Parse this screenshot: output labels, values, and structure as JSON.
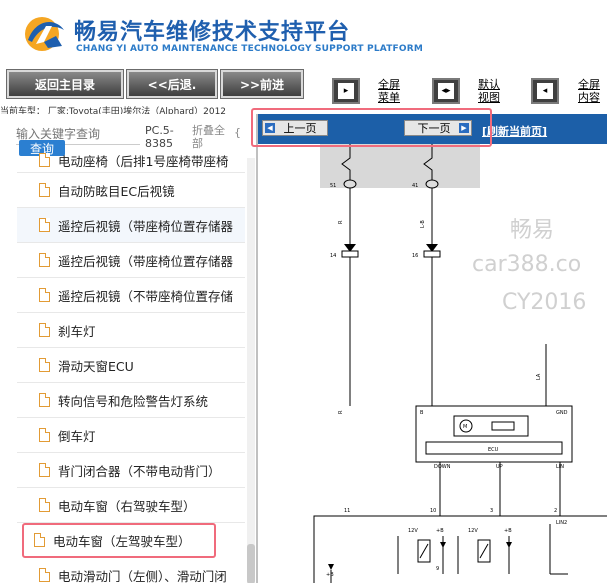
{
  "header": {
    "title_cn": "畅易汽车维修技术支持平台",
    "title_en": "CHANG YI AUTO MAINTENANCE TECHNOLOGY SUPPORT PLATFORM"
  },
  "toolbar": {
    "back_main": "返回主目录",
    "back": "<<后退.",
    "forward": ">>前进",
    "fullscreen_menu": [
      "全屏",
      "菜单"
    ],
    "default_view": [
      "默认",
      "视图"
    ],
    "fullscreen_content": [
      "全屏",
      "内容"
    ]
  },
  "car_info": "当前车型：  厂家:Toyota(丰田)埃尔法（Alphard）2012",
  "sidebar": {
    "search_placeholder": "输入关键字查询",
    "search_button": "查询",
    "pc_label": "PC.5-8385",
    "fold_all": "折叠全部",
    "fold_bracket": "{",
    "items": [
      {
        "label": "电动座椅（后排1号座椅带座椅"
      },
      {
        "label": "自动防眩目EC后视镜"
      },
      {
        "label": "遥控后视镜（带座椅位置存储器"
      },
      {
        "label": "遥控后视镜（带座椅位置存储器"
      },
      {
        "label": "遥控后视镜（不带座椅位置存储"
      },
      {
        "label": "刹车灯"
      },
      {
        "label": "滑动天窗ECU"
      },
      {
        "label": "转向信号和危险警告灯系统"
      },
      {
        "label": "倒车灯"
      },
      {
        "label": "背门闭合器（不带电动背门）"
      },
      {
        "label": "电动车窗（右驾驶车型）"
      },
      {
        "label": "电动车窗（左驾驶车型）"
      },
      {
        "label": "电动滑动门（左侧）、滑动门闭"
      }
    ]
  },
  "diagram": {
    "prev_page": "上一页",
    "next_page": "下一页",
    "refresh": "[刷新当前页]",
    "watermark": [
      "畅易",
      "car388.co",
      "CY2016"
    ],
    "labels": {
      "pin51": "51",
      "pin41": "41",
      "pin14": "14",
      "pin16": "16",
      "wire_r": "R",
      "wire_lab": "L-B",
      "wire_la": "LA",
      "b": "B",
      "gnd": "GND",
      "ecu": "ECU",
      "m": "M",
      "down": "DOWN",
      "up": "UP",
      "lin": "LIN",
      "lin2": "LIN2",
      "v12a": "12V",
      "v12b": "12V",
      "v8a": "+B",
      "v8b": "+B",
      "v8c": "+B",
      "n11": "11",
      "n10": "10",
      "n3": "3",
      "n2": "2",
      "n9": "9"
    }
  },
  "colors": {
    "brand_blue": "#1f5fae",
    "pagebar_blue": "#1c5fa8",
    "highlight_pink": "#f06b7c",
    "doc_icon_orange": "#e29b35"
  },
  "icons": {
    "logo": "cy-logo-icon",
    "doc": "document-icon",
    "fullscreen_menu": "fullscreen-menu-icon",
    "default_view": "default-view-icon",
    "fullscreen_content": "fullscreen-content-icon",
    "left_arrow": "arrow-left-icon",
    "right_arrow": "arrow-right-icon"
  }
}
